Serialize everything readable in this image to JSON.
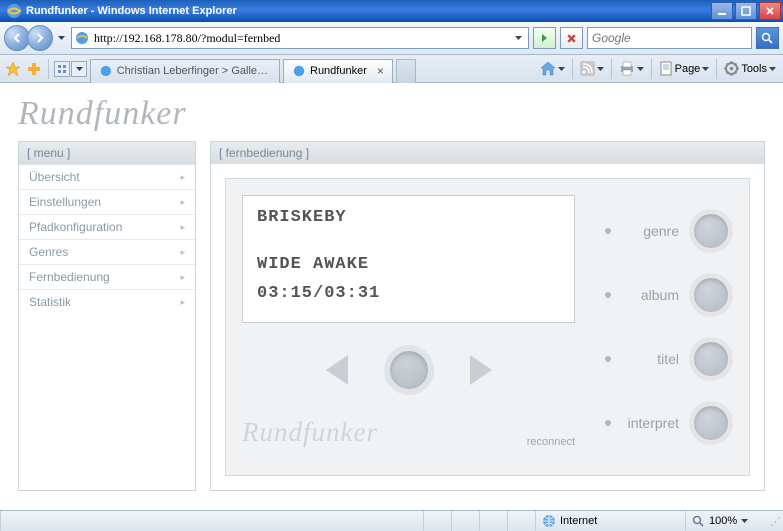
{
  "window": {
    "title": "Rundfunker - Windows Internet Explorer"
  },
  "nav": {
    "url": "http://192.168.178.80/?modul=fernbed",
    "search_placeholder": "Google"
  },
  "tabs": {
    "tab1": "Christian Leberfinger > Gallery...",
    "tab2": "Rundfunker"
  },
  "toolbar": {
    "page": "Page",
    "tools": "Tools"
  },
  "page": {
    "logo": "Rundfunker",
    "menu_header": "[ menu ]",
    "main_header": "[ fernbedienung ]",
    "menu": {
      "item0": "Übersicht",
      "item1": "Einstellungen",
      "item2": "Pfadkonfiguration",
      "item3": "Genres",
      "item4": "Fernbedienung",
      "item5": "Statistik"
    },
    "display": {
      "artist": "BRISKEBY",
      "title": "WIDE AWAKE",
      "time": "03:15/03:31"
    },
    "logo2": "Rundfunker",
    "reconnect": "reconnect",
    "controls": {
      "c0": "genre",
      "c1": "album",
      "c2": "titel",
      "c3": "interpret"
    }
  },
  "status": {
    "zone": "Internet",
    "zoom": "100%"
  }
}
